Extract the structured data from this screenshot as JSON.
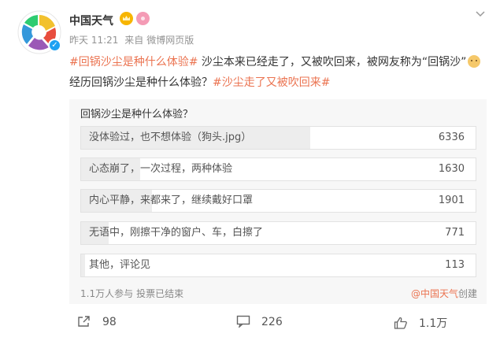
{
  "author": {
    "name": "中国天气",
    "avatar_icon": "china-weather-logo",
    "verified_icon": "verified-badge-icon",
    "badges": [
      "crown-badge-icon",
      "flower-badge-icon"
    ]
  },
  "meta": {
    "time": "昨天 11:21",
    "source_prefix": "来自",
    "source": "微博网页版"
  },
  "more_icon": "chevron-down-icon",
  "post": {
    "tag1": "#回锅沙尘是种什么体验#",
    "text1": " 沙尘本来已经走了，又被吹回来，被网友称为“回锅沙”",
    "emoji": "doge-emoji",
    "text2": "经历回锅沙尘是种什么体验？",
    "tag2": "#沙尘走了又被吹回来#"
  },
  "poll": {
    "title": "回锅沙尘是种什么体验？",
    "options": [
      {
        "label": "没体验过，也不想体验（狗头.jpg）",
        "count": "6336",
        "fraction": 0.58
      },
      {
        "label": "心态崩了，一次过程，两种体验",
        "count": "1630",
        "fraction": 0.15
      },
      {
        "label": "内心平静，来都来了，继续戴好口罩",
        "count": "1901",
        "fraction": 0.18
      },
      {
        "label": "无语中，刚擦干净的窗户、车，白擦了",
        "count": "771",
        "fraction": 0.07
      },
      {
        "label": "其他，评论见",
        "count": "113",
        "fraction": 0.01
      }
    ],
    "participants": "1.1万人参与",
    "status": "投票已结束",
    "creator_prefix": "@",
    "creator": "中国天气",
    "creator_suffix": "创建"
  },
  "actions": {
    "share_count": "98",
    "comment_count": "226",
    "like_count": "1.1万"
  },
  "colors": {
    "link_orange": "#eb7350",
    "poll_bg": "#f7f7f7",
    "bar_fill": "#ededed"
  }
}
